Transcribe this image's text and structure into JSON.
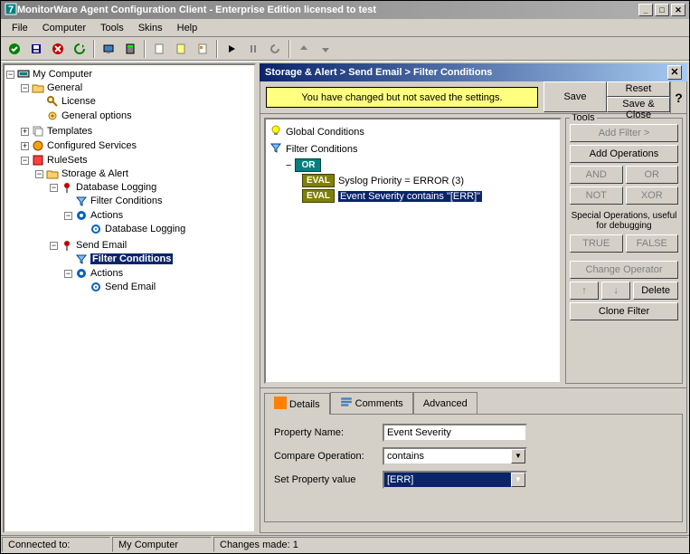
{
  "window": {
    "title": "MonitorWare Agent Configuration Client - Enterprise Edition licensed to test"
  },
  "menu": {
    "file": "File",
    "computer": "Computer",
    "tools": "Tools",
    "skins": "Skins",
    "help": "Help"
  },
  "tree": {
    "root": "My Computer",
    "general": "General",
    "license": "License",
    "genopts": "General options",
    "templates": "Templates",
    "confsvc": "Configured Services",
    "rulesets": "RuleSets",
    "storage": "Storage & Alert",
    "dblog": "Database Logging",
    "filtcond": "Filter Conditions",
    "actions": "Actions",
    "dblog2": "Database Logging",
    "sendemail": "Send Email",
    "filtcond2": "Filter Conditions",
    "actions2": "Actions",
    "sendemail2": "Send Email"
  },
  "header": {
    "breadcrumb": "Storage & Alert > Send Email > Filter Conditions"
  },
  "actions": {
    "save": "Save",
    "reset": "Reset",
    "saveclose": "Save & Close",
    "notice": "You have changed but not saved the settings."
  },
  "filter": {
    "global": "Global Conditions",
    "filtcond": "Filter Conditions",
    "or": "OR",
    "eval": "EVAL",
    "rule1": "Syslog Priority = ERROR (3)",
    "rule2": "Event Severity contains \"[ERR]\""
  },
  "tools": {
    "label": "Tools",
    "addfilter": "Add Filter >",
    "addops": "Add Operations",
    "and": "AND",
    "or": "OR",
    "not": "NOT",
    "xor": "XOR",
    "spops": "Special Operations, useful for debugging",
    "true": "TRUE",
    "false": "FALSE",
    "changeop": "Change Operator",
    "delete": "Delete",
    "clone": "Clone Filter"
  },
  "tabs": {
    "details": "Details",
    "comments": "Comments",
    "advanced": "Advanced"
  },
  "form": {
    "propname_label": "Property Name:",
    "propname_value": "Event Severity",
    "compop_label": "Compare Operation:",
    "compop_value": "contains",
    "setprop_label": "Set Property value",
    "setprop_value": "[ERR]"
  },
  "status": {
    "conn": "Connected to:",
    "comp": "My Computer",
    "changes": "Changes made: 1"
  }
}
